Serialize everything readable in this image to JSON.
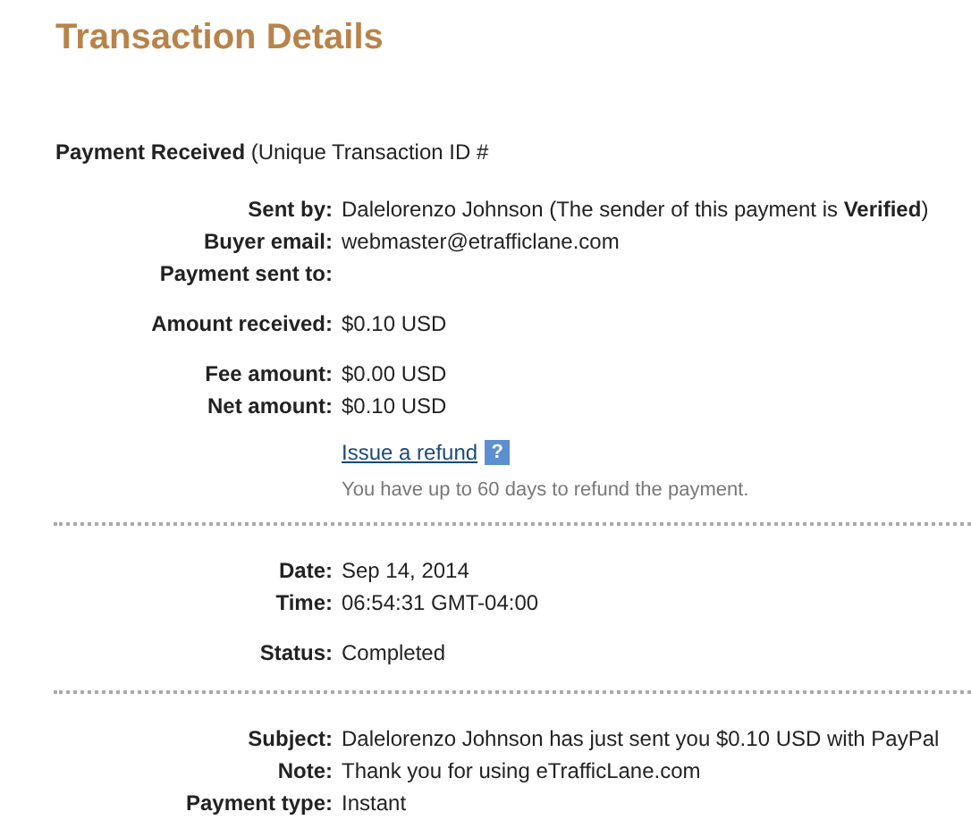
{
  "title": "Transaction Details",
  "payment_received": "**Payment Received** (Unique Transaction ID #",
  "sections": [
    {
      "groups": [
        [
          {
            "label": "Sent by:",
            "value": "Dalelorenzo Johnson (The sender of this payment is **Verified**)"
          },
          {
            "label": "Buyer email:",
            "value": "webmaster@etrafficlane.com"
          },
          {
            "label": "Payment sent to:"
          }
        ],
        [
          {
            "label": "Amount received:",
            "value": "$0.10 USD"
          }
        ],
        [
          {
            "label": "Fee amount:",
            "value": "$0.00 USD"
          },
          {
            "label": "Net amount:",
            "value": "$0.10 USD"
          }
        ]
      ],
      "refund": {
        "link": "Issue a refund",
        "help": "?",
        "note": "You have up to 60 days to refund the payment."
      }
    },
    {
      "groups": [
        [
          {
            "label": "Date:",
            "value": "Sep 14, 2014"
          },
          {
            "label": "Time:",
            "value": "06:54:31 GMT-04:00"
          }
        ],
        [
          {
            "label": "Status:",
            "value": "Completed"
          }
        ]
      ]
    },
    {
      "groups": [
        [
          {
            "label": "Subject:",
            "value": "Dalelorenzo Johnson has just sent you $0.10 USD with PayPal"
          },
          {
            "label": "Note:",
            "value": "Thank you for using eTrafficLane.com"
          },
          {
            "label": "Payment type:",
            "value": "Instant"
          }
        ]
      ]
    }
  ]
}
